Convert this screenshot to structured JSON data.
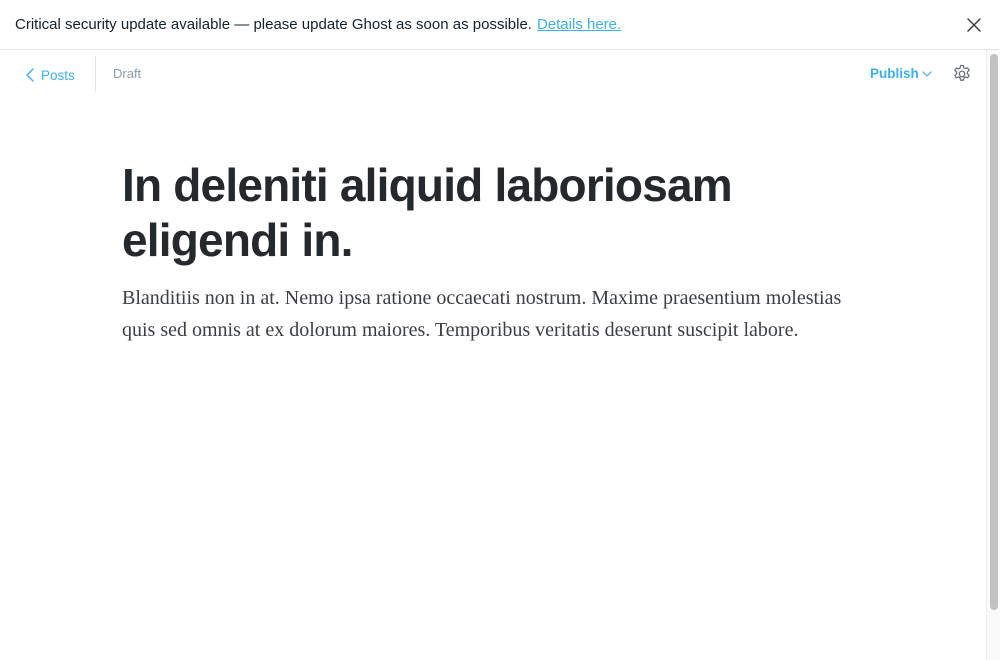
{
  "banner": {
    "message": "Critical security update available — please update Ghost as soon as possible.",
    "link_text": "Details here.",
    "close_icon": "close-icon"
  },
  "toolbar": {
    "back_label": "Posts",
    "back_icon": "chevron-left-icon",
    "status": "Draft",
    "publish_label": "Publish",
    "publish_icon": "chevron-down-icon",
    "settings_icon": "gear-icon"
  },
  "post": {
    "title": "In deleniti aliquid laboriosam eligendi in.",
    "body": "Blanditiis non in at. Nemo ipsa ratione occaecati nostrum. Maxime praesentium molestias quis sed omnis at ex dolorum maiores. Temporibus veritatis deserunt suscipit labore."
  },
  "colors": {
    "accent": "#3eb0ef",
    "muted": "#8e9cac",
    "title": "#25292c",
    "body": "#3a3f43"
  }
}
